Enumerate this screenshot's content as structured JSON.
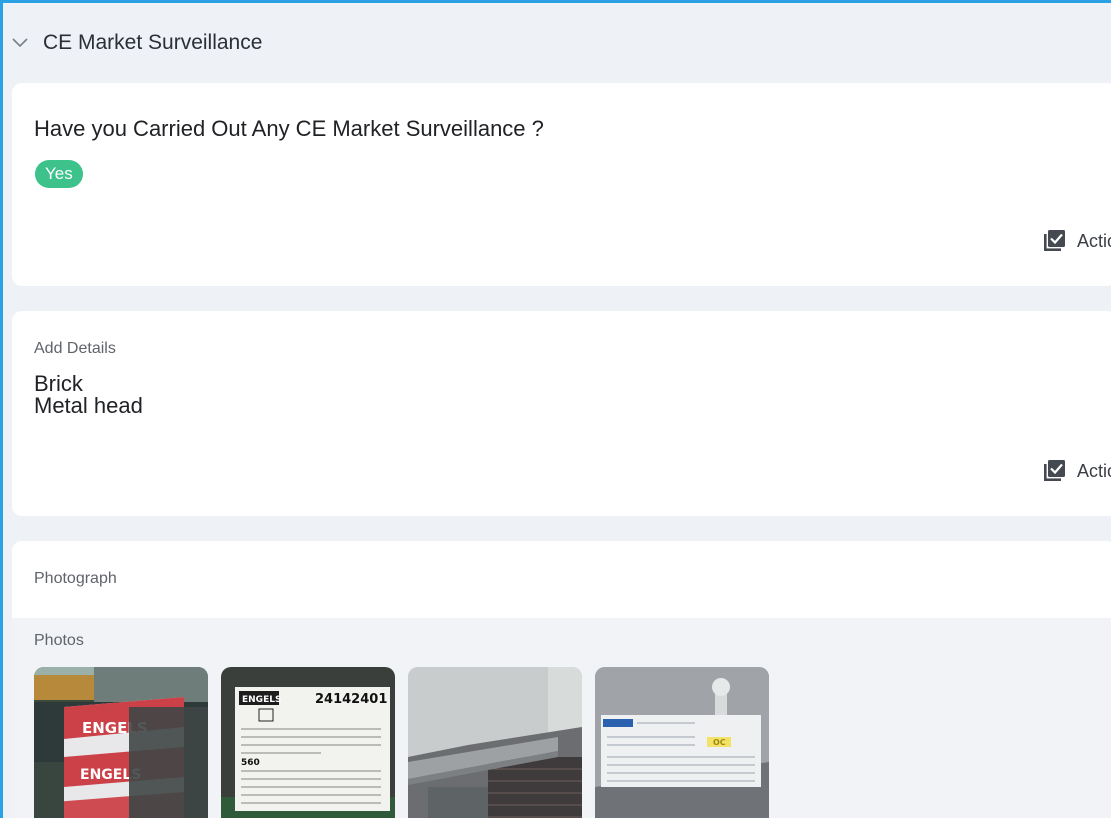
{
  "section": {
    "title": "CE Market Surveillance"
  },
  "question_card": {
    "question": "Have you Carried Out Any CE Market Surveillance ?",
    "answer": "Yes",
    "action_label": "Actio"
  },
  "details_card": {
    "label": "Add Details",
    "lines": [
      "Brick",
      "Metal head"
    ],
    "action_label": "Actio"
  },
  "photo_card": {
    "label": "Photograph",
    "photos_label": "Photos",
    "photo2_number": "24142401",
    "photo2_brand": "ENGELS",
    "photo2_code": "560",
    "photo4_badge": "OC"
  },
  "colors": {
    "accent_border": "#2aa1e3",
    "yes_pill": "#3cc28a",
    "background": "#eef1f6"
  }
}
